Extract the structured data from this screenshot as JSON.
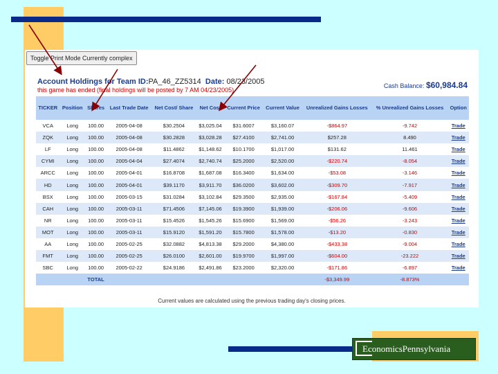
{
  "toggle_button": {
    "label": "Toggle Print Mode Currently complex"
  },
  "header": {
    "title_prefix": "Account Holdings for Team ID:",
    "team_id": "PA_46_ZZ5314",
    "date_label": "Date:",
    "date_value": "08/23/2005",
    "notice": "this game has ended (final holdings will be posted by 7 AM 04/23/2005)",
    "cash_label": "Cash Balance:",
    "cash_value": "$60,984.84"
  },
  "table": {
    "columns": [
      "TICKER",
      "Position",
      "Shares",
      "Last Trade Date",
      "Net Cost/ Share",
      "Net Cost",
      "Current Price",
      "Current Value",
      "Unrealized Gains Losses",
      "% Unrealized Gains Losses",
      "Option"
    ],
    "rows": [
      [
        "VCA",
        "Long",
        "100.00",
        "2005-04-08",
        "$30.2504",
        "$3,025.04",
        "$31.6007",
        "$3,160.07",
        "-$864.97",
        "-9.742",
        "Trade"
      ],
      [
        "ZQK",
        "Long",
        "100.00",
        "2005-04-08",
        "$30.2828",
        "$3,028.28",
        "$27.4100",
        "$2,741.00",
        "$257.28",
        "8.490",
        "Trade"
      ],
      [
        "LF",
        "Long",
        "100.00",
        "2005-04-08",
        "$11.4862",
        "$1,148.62",
        "$10.1700",
        "$1,017.00",
        "$131.62",
        "11.461",
        "Trade"
      ],
      [
        "CYMI",
        "Long",
        "100.00",
        "2005-04-04",
        "$27.4074",
        "$2,740.74",
        "$25.2000",
        "$2,520.00",
        "-$220.74",
        "-8.054",
        "Trade"
      ],
      [
        "ARCC",
        "Long",
        "100.00",
        "2005-04-01",
        "$16.8708",
        "$1,687.08",
        "$16.3400",
        "$1,634.00",
        "-$53.08",
        "-3.146",
        "Trade"
      ],
      [
        "HD",
        "Long",
        "100.00",
        "2005-04-01",
        "$39.1170",
        "$3,911.70",
        "$36.0200",
        "$3,602.00",
        "-$309.70",
        "-7.917",
        "Trade"
      ],
      [
        "BSX",
        "Long",
        "100.00",
        "2005-03-15",
        "$31.0284",
        "$3,102.84",
        "$29.3500",
        "$2,935.00",
        "-$167.84",
        "-5.409",
        "Trade"
      ],
      [
        "CAH",
        "Long",
        "100.00",
        "2005-03-11",
        "$71.4506",
        "$7,145.06",
        "$19.3900",
        "$1,939.00",
        "-$206.06",
        "-9.606",
        "Trade"
      ],
      [
        "NR",
        "Long",
        "100.00",
        "2005-03-11",
        "$15.4526",
        "$1,545.26",
        "$15.6900",
        "$1,569.00",
        "-$56.26",
        "-3.243",
        "Trade"
      ],
      [
        "MOT",
        "Long",
        "100.00",
        "2005-03-11",
        "$15.9120",
        "$1,591.20",
        "$15.7800",
        "$1,578.00",
        "-$13.20",
        "-0.830",
        "Trade"
      ],
      [
        "AA",
        "Long",
        "100.00",
        "2005-02-25",
        "$32.0882",
        "$4,813.38",
        "$29.2000",
        "$4,380.00",
        "-$433.38",
        "-9.004",
        "Trade"
      ],
      [
        "FMT",
        "Long",
        "100.00",
        "2005-02-25",
        "$26.0100",
        "$2,601.00",
        "$19.9700",
        "$1,997.00",
        "-$604.00",
        "-23.222",
        "Trade"
      ],
      [
        "SBC",
        "Long",
        "100.00",
        "2005-02-22",
        "$24.9186",
        "$2,491.86",
        "$23.2000",
        "$2,320.00",
        "-$171.86",
        "-6.897",
        "Trade"
      ]
    ],
    "total": {
      "label": "TOTAL",
      "gains": "-$3,349.99",
      "pct": "-8.873%"
    }
  },
  "footnote": "Current values are calculated using the previous trading day's closing prices.",
  "logo": {
    "text": "EconomicsPennsylvania"
  },
  "colors": {
    "background": "#ccffff",
    "accent_bar": "#0a2a8a",
    "block": "#ffcc66",
    "header_row": "#b9d3f5",
    "alt_row": "#dde9f8",
    "arrow": "#8b0000"
  }
}
